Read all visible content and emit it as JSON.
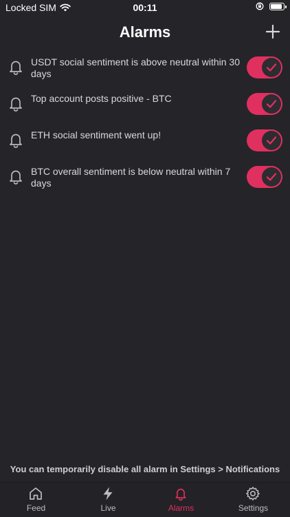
{
  "status_bar": {
    "carrier": "Locked SIM",
    "time": "00:11"
  },
  "header": {
    "title": "Alarms",
    "add_icon": "plus-icon"
  },
  "alarms": [
    {
      "text": "USDT social sentiment is above neutral within 30 days",
      "enabled": true
    },
    {
      "text": "Top account posts positive - BTC",
      "enabled": true
    },
    {
      "text": "ETH social sentiment went up!",
      "enabled": true
    },
    {
      "text": "BTC overall sentiment is below neutral within 7 days",
      "enabled": true
    }
  ],
  "footer_note": "You can temporarily disable all alarm in Settings > Notifications",
  "tabs": [
    {
      "label": "Feed",
      "icon": "home-icon",
      "active": false
    },
    {
      "label": "Live",
      "icon": "lightning-icon",
      "active": false
    },
    {
      "label": "Alarms",
      "icon": "bell-icon",
      "active": true
    },
    {
      "label": "Settings",
      "icon": "gear-icon",
      "active": false
    }
  ],
  "colors": {
    "accent": "#e0305f",
    "background": "#252429"
  }
}
